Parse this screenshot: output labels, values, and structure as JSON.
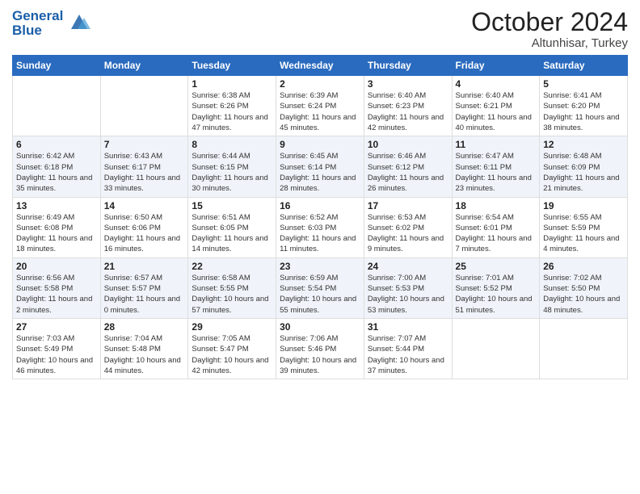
{
  "header": {
    "logo_line1": "General",
    "logo_line2": "Blue",
    "month": "October 2024",
    "location": "Altunhisar, Turkey"
  },
  "days_of_week": [
    "Sunday",
    "Monday",
    "Tuesday",
    "Wednesday",
    "Thursday",
    "Friday",
    "Saturday"
  ],
  "weeks": [
    [
      {
        "day": "",
        "sunrise": "",
        "sunset": "",
        "daylight": ""
      },
      {
        "day": "",
        "sunrise": "",
        "sunset": "",
        "daylight": ""
      },
      {
        "day": "1",
        "sunrise": "Sunrise: 6:38 AM",
        "sunset": "Sunset: 6:26 PM",
        "daylight": "Daylight: 11 hours and 47 minutes."
      },
      {
        "day": "2",
        "sunrise": "Sunrise: 6:39 AM",
        "sunset": "Sunset: 6:24 PM",
        "daylight": "Daylight: 11 hours and 45 minutes."
      },
      {
        "day": "3",
        "sunrise": "Sunrise: 6:40 AM",
        "sunset": "Sunset: 6:23 PM",
        "daylight": "Daylight: 11 hours and 42 minutes."
      },
      {
        "day": "4",
        "sunrise": "Sunrise: 6:40 AM",
        "sunset": "Sunset: 6:21 PM",
        "daylight": "Daylight: 11 hours and 40 minutes."
      },
      {
        "day": "5",
        "sunrise": "Sunrise: 6:41 AM",
        "sunset": "Sunset: 6:20 PM",
        "daylight": "Daylight: 11 hours and 38 minutes."
      }
    ],
    [
      {
        "day": "6",
        "sunrise": "Sunrise: 6:42 AM",
        "sunset": "Sunset: 6:18 PM",
        "daylight": "Daylight: 11 hours and 35 minutes."
      },
      {
        "day": "7",
        "sunrise": "Sunrise: 6:43 AM",
        "sunset": "Sunset: 6:17 PM",
        "daylight": "Daylight: 11 hours and 33 minutes."
      },
      {
        "day": "8",
        "sunrise": "Sunrise: 6:44 AM",
        "sunset": "Sunset: 6:15 PM",
        "daylight": "Daylight: 11 hours and 30 minutes."
      },
      {
        "day": "9",
        "sunrise": "Sunrise: 6:45 AM",
        "sunset": "Sunset: 6:14 PM",
        "daylight": "Daylight: 11 hours and 28 minutes."
      },
      {
        "day": "10",
        "sunrise": "Sunrise: 6:46 AM",
        "sunset": "Sunset: 6:12 PM",
        "daylight": "Daylight: 11 hours and 26 minutes."
      },
      {
        "day": "11",
        "sunrise": "Sunrise: 6:47 AM",
        "sunset": "Sunset: 6:11 PM",
        "daylight": "Daylight: 11 hours and 23 minutes."
      },
      {
        "day": "12",
        "sunrise": "Sunrise: 6:48 AM",
        "sunset": "Sunset: 6:09 PM",
        "daylight": "Daylight: 11 hours and 21 minutes."
      }
    ],
    [
      {
        "day": "13",
        "sunrise": "Sunrise: 6:49 AM",
        "sunset": "Sunset: 6:08 PM",
        "daylight": "Daylight: 11 hours and 18 minutes."
      },
      {
        "day": "14",
        "sunrise": "Sunrise: 6:50 AM",
        "sunset": "Sunset: 6:06 PM",
        "daylight": "Daylight: 11 hours and 16 minutes."
      },
      {
        "day": "15",
        "sunrise": "Sunrise: 6:51 AM",
        "sunset": "Sunset: 6:05 PM",
        "daylight": "Daylight: 11 hours and 14 minutes."
      },
      {
        "day": "16",
        "sunrise": "Sunrise: 6:52 AM",
        "sunset": "Sunset: 6:03 PM",
        "daylight": "Daylight: 11 hours and 11 minutes."
      },
      {
        "day": "17",
        "sunrise": "Sunrise: 6:53 AM",
        "sunset": "Sunset: 6:02 PM",
        "daylight": "Daylight: 11 hours and 9 minutes."
      },
      {
        "day": "18",
        "sunrise": "Sunrise: 6:54 AM",
        "sunset": "Sunset: 6:01 PM",
        "daylight": "Daylight: 11 hours and 7 minutes."
      },
      {
        "day": "19",
        "sunrise": "Sunrise: 6:55 AM",
        "sunset": "Sunset: 5:59 PM",
        "daylight": "Daylight: 11 hours and 4 minutes."
      }
    ],
    [
      {
        "day": "20",
        "sunrise": "Sunrise: 6:56 AM",
        "sunset": "Sunset: 5:58 PM",
        "daylight": "Daylight: 11 hours and 2 minutes."
      },
      {
        "day": "21",
        "sunrise": "Sunrise: 6:57 AM",
        "sunset": "Sunset: 5:57 PM",
        "daylight": "Daylight: 11 hours and 0 minutes."
      },
      {
        "day": "22",
        "sunrise": "Sunrise: 6:58 AM",
        "sunset": "Sunset: 5:55 PM",
        "daylight": "Daylight: 10 hours and 57 minutes."
      },
      {
        "day": "23",
        "sunrise": "Sunrise: 6:59 AM",
        "sunset": "Sunset: 5:54 PM",
        "daylight": "Daylight: 10 hours and 55 minutes."
      },
      {
        "day": "24",
        "sunrise": "Sunrise: 7:00 AM",
        "sunset": "Sunset: 5:53 PM",
        "daylight": "Daylight: 10 hours and 53 minutes."
      },
      {
        "day": "25",
        "sunrise": "Sunrise: 7:01 AM",
        "sunset": "Sunset: 5:52 PM",
        "daylight": "Daylight: 10 hours and 51 minutes."
      },
      {
        "day": "26",
        "sunrise": "Sunrise: 7:02 AM",
        "sunset": "Sunset: 5:50 PM",
        "daylight": "Daylight: 10 hours and 48 minutes."
      }
    ],
    [
      {
        "day": "27",
        "sunrise": "Sunrise: 7:03 AM",
        "sunset": "Sunset: 5:49 PM",
        "daylight": "Daylight: 10 hours and 46 minutes."
      },
      {
        "day": "28",
        "sunrise": "Sunrise: 7:04 AM",
        "sunset": "Sunset: 5:48 PM",
        "daylight": "Daylight: 10 hours and 44 minutes."
      },
      {
        "day": "29",
        "sunrise": "Sunrise: 7:05 AM",
        "sunset": "Sunset: 5:47 PM",
        "daylight": "Daylight: 10 hours and 42 minutes."
      },
      {
        "day": "30",
        "sunrise": "Sunrise: 7:06 AM",
        "sunset": "Sunset: 5:46 PM",
        "daylight": "Daylight: 10 hours and 39 minutes."
      },
      {
        "day": "31",
        "sunrise": "Sunrise: 7:07 AM",
        "sunset": "Sunset: 5:44 PM",
        "daylight": "Daylight: 10 hours and 37 minutes."
      },
      {
        "day": "",
        "sunrise": "",
        "sunset": "",
        "daylight": ""
      },
      {
        "day": "",
        "sunrise": "",
        "sunset": "",
        "daylight": ""
      }
    ]
  ]
}
